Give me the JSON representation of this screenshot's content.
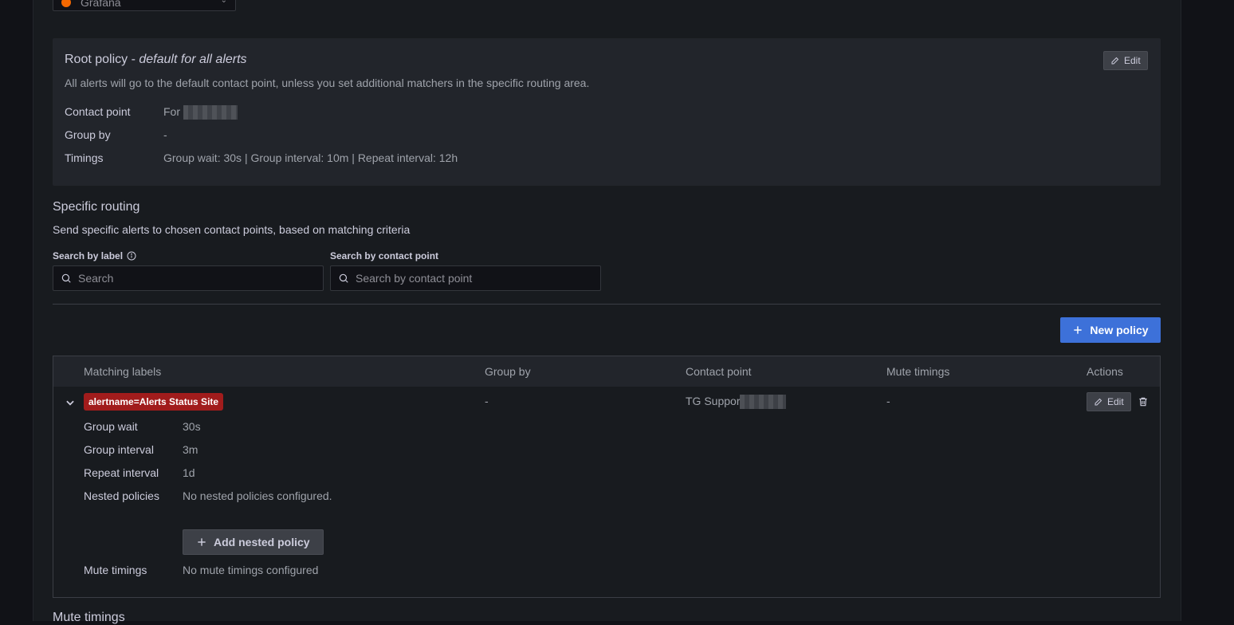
{
  "datasource": {
    "name": "Grafana",
    "icon": "grafana-logo-icon"
  },
  "root_policy": {
    "title": "Root policy - ",
    "title_emphasis": "default for all alerts",
    "description": "All alerts will go to the default contact point, unless you set additional matchers in the specific routing area.",
    "edit_label": "Edit",
    "rows": [
      {
        "label": "Contact point",
        "value": "For"
      },
      {
        "label": "Group by",
        "value": "-"
      },
      {
        "label": "Timings",
        "value": "Group wait: 30s | Group interval: 10m | Repeat interval: 12h"
      }
    ]
  },
  "specific_routing": {
    "title": "Specific routing",
    "description": "Send specific alerts to chosen contact points, based on matching criteria",
    "search_label": {
      "label": "Search by label",
      "placeholder": "Search"
    },
    "search_contact": {
      "label": "Search by contact point",
      "placeholder": "Search by contact point"
    },
    "new_policy_label": "New policy"
  },
  "table": {
    "headers": {
      "matching_labels": "Matching labels",
      "group_by": "Group by",
      "contact_point": "Contact point",
      "mute_timings": "Mute timings",
      "actions": "Actions"
    },
    "row": {
      "matcher": "alertname=Alerts Status Site",
      "group_by": "-",
      "contact_point": "TG Suppor",
      "mute_timings": "-",
      "edit_label": "Edit",
      "details": [
        {
          "label": "Group wait",
          "value": "30s"
        },
        {
          "label": "Group interval",
          "value": "3m"
        },
        {
          "label": "Repeat interval",
          "value": "1d"
        },
        {
          "label": "Nested policies",
          "value": "No nested policies configured."
        }
      ],
      "add_nested_label": "Add nested policy",
      "mute_label": "Mute timings",
      "mute_value": "No mute timings configured"
    }
  },
  "next_section_title": "Mute timings",
  "colors": {
    "primary": "#3d71d9",
    "matcher_bg": "#a11c1c",
    "panel": "#22252b"
  }
}
